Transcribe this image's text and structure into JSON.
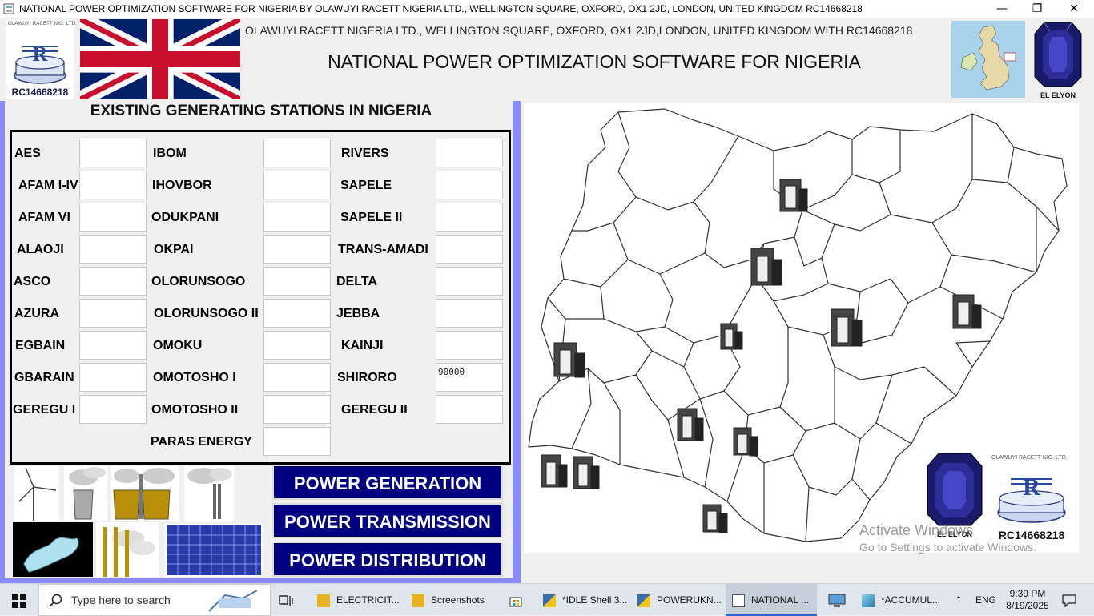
{
  "window": {
    "title": "NATIONAL POWER OPTIMIZATION SOFTWARE FOR NIGERIA BY OLAWUYI RACETT NIGERIA LTD., WELLINGTON SQUARE, OXFORD, OX1 2JD, LONDON, UNITED KINGDOM RC14668218",
    "minimize": "—",
    "maximize": "❐",
    "close": "✕"
  },
  "header": {
    "logo_tiny_text": "OLAWUYI RACETT NIG. LTD.",
    "logo_rc": "RC14668218",
    "marquee": "OLAWUYI RACETT NIGERIA LTD., WELLINGTON SQUARE, OXFORD, OX1 2JD,LONDON, UNITED KINGDOM WITH RC14668218",
    "title": "NATIONAL POWER OPTIMIZATION SOFTWARE FOR NIGERIA",
    "gem_label": "EL ELYON"
  },
  "stations": {
    "heading": "EXISTING GENERATING STATIONS IN NIGERIA",
    "col1": [
      {
        "label": "AES",
        "value": ""
      },
      {
        "label": "AFAM I-IV",
        "value": ""
      },
      {
        "label": "AFAM VI",
        "value": ""
      },
      {
        "label": "ALAOJI",
        "value": ""
      },
      {
        "label": "ASCO",
        "value": ""
      },
      {
        "label": "AZURA",
        "value": ""
      },
      {
        "label": "EGBAIN",
        "value": ""
      },
      {
        "label": "GBARAIN",
        "value": ""
      },
      {
        "label": "GEREGU I",
        "value": ""
      }
    ],
    "col2": [
      {
        "label": "IBOM",
        "value": ""
      },
      {
        "label": "IHOVBOR",
        "value": ""
      },
      {
        "label": "ODUKPANI",
        "value": ""
      },
      {
        "label": "OKPAI",
        "value": ""
      },
      {
        "label": "OLORUNSOGO",
        "value": ""
      },
      {
        "label": "OLORUNSOGO II",
        "value": ""
      },
      {
        "label": "OMOKU",
        "value": ""
      },
      {
        "label": "OMOTOSHO I",
        "value": ""
      },
      {
        "label": "OMOTOSHO II",
        "value": ""
      },
      {
        "label": "PARAS ENERGY",
        "value": ""
      }
    ],
    "col3": [
      {
        "label": "RIVERS",
        "value": ""
      },
      {
        "label": "SAPELE",
        "value": ""
      },
      {
        "label": "SAPELE II",
        "value": ""
      },
      {
        "label": "TRANS-AMADI",
        "value": ""
      },
      {
        "label": "DELTA",
        "value": ""
      },
      {
        "label": "JEBBA",
        "value": ""
      },
      {
        "label": "KAINJI",
        "value": ""
      },
      {
        "label": "SHIRORO",
        "value": "90000"
      },
      {
        "label": "GEREGU II",
        "value": ""
      }
    ]
  },
  "buttons": {
    "generation": "POWER GENERATION",
    "transmission": "POWER TRANSMISSION",
    "distribution": "POWER DISTRIBUTION"
  },
  "bottom_right": {
    "gem_label": "EL ELYON",
    "logo_tiny_text": "OLAWUYI RACETT NIG. LTD.",
    "logo_rc": "RC14668218"
  },
  "watermark": {
    "line1": "Activate Windows",
    "line2": "Go to Settings to activate Windows."
  },
  "taskbar": {
    "search_placeholder": "Type here to search",
    "items": [
      {
        "label": "ELECTRICIT..."
      },
      {
        "label": "Screenshots"
      },
      {
        "label": "*IDLE Shell 3..."
      },
      {
        "label": "POWERUKN..."
      },
      {
        "label": "NATIONAL ..."
      },
      {
        "label": "*ACCUMUL..."
      }
    ],
    "language": "ENG",
    "time": "9:39 PM",
    "date": "8/19/2025"
  },
  "colors": {
    "button_bg": "#000080",
    "panel_border": "#8a8aff",
    "taskbar_bg": "#dfe6ee"
  }
}
